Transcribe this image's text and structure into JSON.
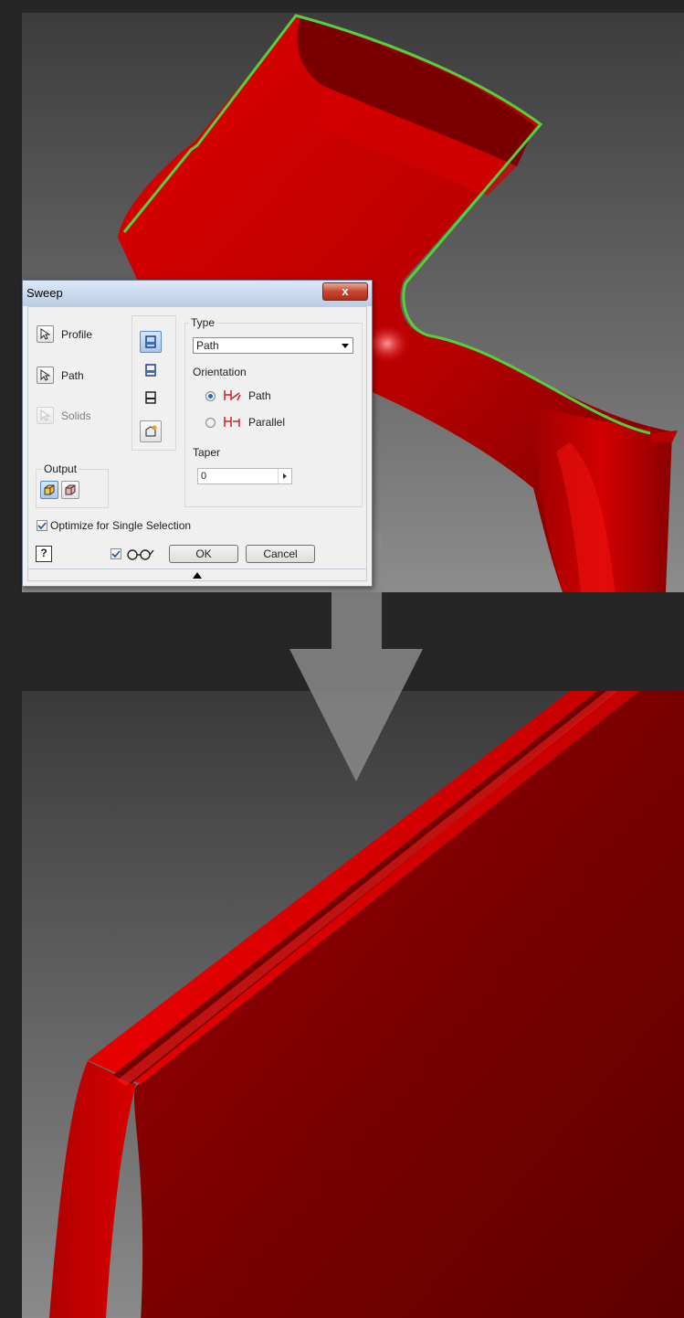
{
  "dialog": {
    "title": "Sweep",
    "close_label": "x",
    "profile_label": "Profile",
    "path_label": "Path",
    "solids_label": "Solids",
    "output_label": "Output",
    "type_label": "Type",
    "type_value": "Path",
    "orientation_label": "Orientation",
    "orientation_options": [
      {
        "label": "Path",
        "checked": true
      },
      {
        "label": "Parallel",
        "checked": false
      }
    ],
    "taper_label": "Taper",
    "taper_value": "0",
    "optimize_label": "Optimize for Single Selection",
    "optimize_checked": true,
    "help_label": "?",
    "ok_label": "OK",
    "cancel_label": "Cancel"
  },
  "colors": {
    "part_red": "#c80000",
    "highlight_green": "#55d03a",
    "background": "#262626"
  },
  "icons": {
    "profile_select": "cursor-arrow-icon",
    "path_select": "cursor-arrow-icon",
    "solids_select": "cursor-arrow-icon",
    "output_solid": "solid-body-icon",
    "output_surface": "surface-body-icon",
    "preview": "glasses-icon",
    "expander": "triangle-up-icon"
  }
}
